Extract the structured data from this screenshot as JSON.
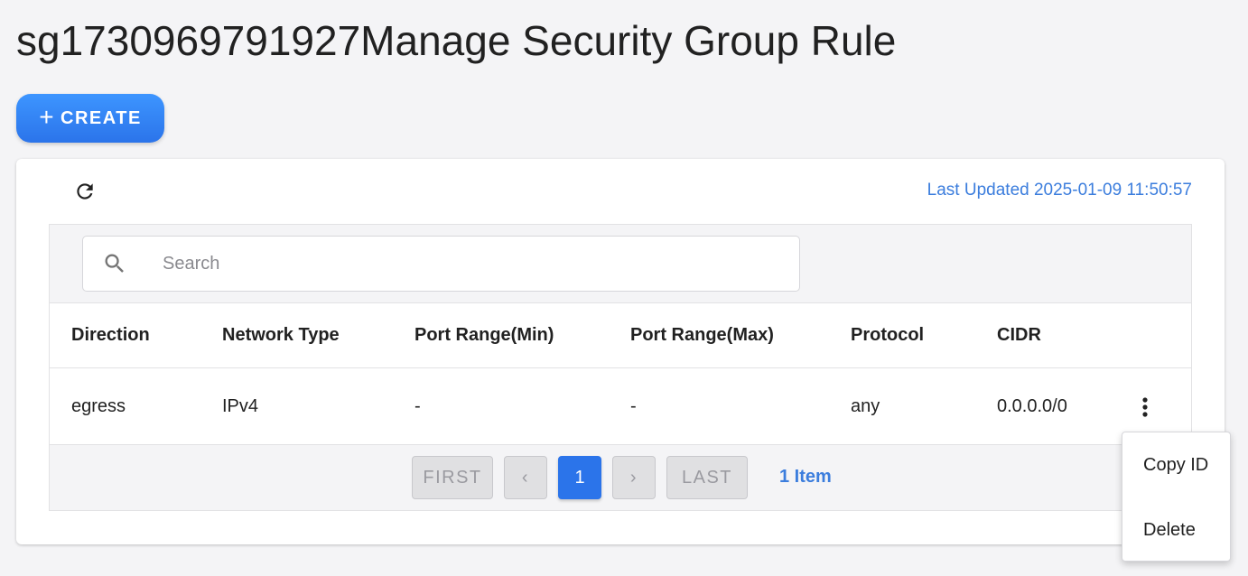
{
  "page": {
    "title": "sg1730969791927Manage Security Group Rule"
  },
  "toolbar": {
    "create_label": "CREATE"
  },
  "status": {
    "last_updated": "Last Updated 2025-01-09 11:50:57"
  },
  "search": {
    "placeholder": "Search",
    "value": ""
  },
  "table": {
    "columns": [
      "Direction",
      "Network Type",
      "Port Range(Min)",
      "Port Range(Max)",
      "Protocol",
      "CIDR"
    ],
    "rows": [
      [
        "egress",
        "IPv4",
        "-",
        "-",
        "any",
        "0.0.0.0/0"
      ]
    ]
  },
  "pagination": {
    "first": "FIRST",
    "prev": "‹",
    "current": "1",
    "next": "›",
    "last": "LAST",
    "count": "1 Item"
  },
  "context_menu": {
    "items": [
      "Copy ID",
      "Delete"
    ]
  },
  "colors": {
    "accent": "#2b74ea",
    "link": "#3b7ddd",
    "background": "#f4f4f6"
  },
  "icons": {
    "refresh": "refresh-icon",
    "search": "search-icon",
    "more": "more-vertical-icon",
    "add": "plus-icon"
  }
}
